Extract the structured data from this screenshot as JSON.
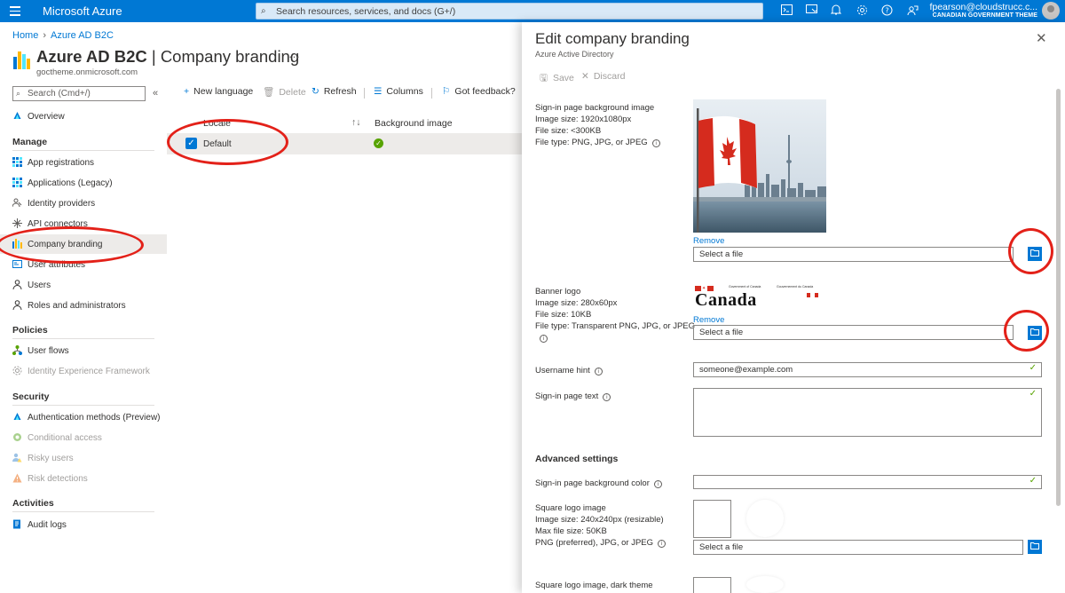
{
  "topbar": {
    "brand": "Microsoft Azure",
    "search_placeholder": "Search resources, services, and docs (G+/)",
    "account_user": "fpearson@cloudstrucc.c...",
    "account_directory": "CANADIAN GOVERNMENT THEME",
    "icons": [
      "cloud-shell-icon",
      "directory-filter-icon",
      "notifications-icon",
      "settings-icon",
      "help-icon",
      "feedback-icon"
    ]
  },
  "breadcrumb": {
    "home": "Home",
    "parent": "Azure AD B2C"
  },
  "header": {
    "title_bold": "Azure AD B2C",
    "title_rest": " | Company branding",
    "subtitle": "goctheme.onmicrosoft.com",
    "more": "···"
  },
  "sidebar": {
    "search_placeholder": "Search (Cmd+/)",
    "collapse": "«",
    "overview": "Overview",
    "sections": {
      "manage": "Manage",
      "policies": "Policies",
      "security": "Security",
      "activities": "Activities"
    },
    "manage_items": [
      "App registrations",
      "Applications (Legacy)",
      "Identity providers",
      "API connectors",
      "Company branding",
      "User attributes",
      "Users",
      "Roles and administrators"
    ],
    "policy_items": [
      "User flows",
      "Identity Experience Framework"
    ],
    "security_items": [
      "Authentication methods (Preview)",
      "Conditional access",
      "Risky users",
      "Risk detections"
    ],
    "activity_items": [
      "Audit logs"
    ]
  },
  "toolbar": {
    "new_language": "New language",
    "delete": "Delete",
    "refresh": "Refresh",
    "columns": "Columns",
    "feedback": "Got feedback?"
  },
  "grid": {
    "headers": [
      "Locale",
      "Background image"
    ],
    "sort_icon": "↑↓",
    "rows": [
      {
        "locale": "Default",
        "background_image": "check"
      }
    ]
  },
  "panel": {
    "title": "Edit company branding",
    "subtitle": "Azure Active Directory",
    "save": "Save",
    "discard": "Discard",
    "bg_image": {
      "label": "Sign-in page background image",
      "size": "Image size: 1920x1080px",
      "filesize": "File size: <300KB",
      "filetype": "File type: PNG, JPG, or JPEG",
      "remove": "Remove",
      "file_placeholder": "Select a file"
    },
    "banner_logo": {
      "label": "Banner logo",
      "size": "Image size: 280x60px",
      "filesize": "File size: 10KB",
      "filetype": "File type: Transparent PNG, JPG, or JPEG",
      "remove": "Remove",
      "file_placeholder": "Select a file",
      "wordmark": "Canada",
      "gov_en": "Government of Canada",
      "gov_fr": "Gouvernement du Canada"
    },
    "username_hint": {
      "label": "Username hint",
      "value": "someone@example.com"
    },
    "signin_text": {
      "label": "Sign-in page text",
      "value": ""
    },
    "advanced": "Advanced settings",
    "bg_color": {
      "label": "Sign-in page background color",
      "value": ""
    },
    "square_logo": {
      "label": "Square logo image",
      "size": "Image size: 240x240px (resizable)",
      "filesize": "Max file size: 50KB",
      "filetype": "PNG (preferred), JPG, or JPEG",
      "file_placeholder": "Select a file"
    },
    "square_logo_dark": {
      "label": "Square logo image, dark theme"
    }
  },
  "colors": {
    "azure_blue": "#0078d4",
    "annotation_red": "#e32119",
    "success_green": "#57a300"
  }
}
